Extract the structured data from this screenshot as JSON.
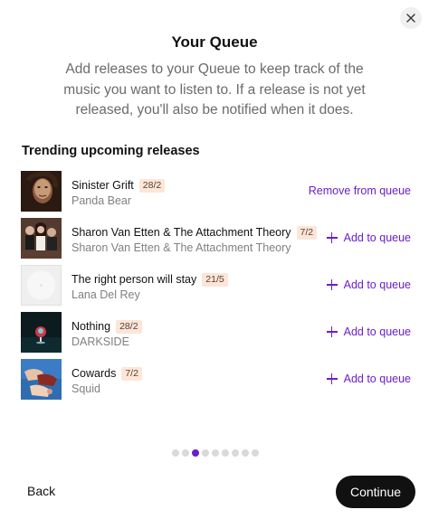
{
  "modal": {
    "title": "Your Queue",
    "description": "Add releases to your Queue to keep track of the music you want to listen to. If a release is not yet released, you'll also be notified when it does.",
    "section_title": "Trending upcoming releases"
  },
  "releases": [
    {
      "title": "Sinister Grift",
      "date": "28/2",
      "artist": "Panda Bear",
      "action": "Remove from queue",
      "in_queue": true,
      "cover": "portrait-painting"
    },
    {
      "title": "Sharon Van Etten & The Attachment Theory",
      "date": "7/2",
      "artist": "Sharon Van Etten & The Attachment Theory",
      "action": "Add to queue",
      "in_queue": false,
      "cover": "band-photo"
    },
    {
      "title": "The right person will stay",
      "date": "21/5",
      "artist": "Lana Del Rey",
      "action": "Add to queue",
      "in_queue": false,
      "cover": "blank-disc"
    },
    {
      "title": "Nothing",
      "date": "28/2",
      "artist": "DARKSIDE",
      "action": "Add to queue",
      "in_queue": false,
      "cover": "dark-orb"
    },
    {
      "title": "Cowards",
      "date": "7/2",
      "artist": "Squid",
      "action": "Add to queue",
      "in_queue": false,
      "cover": "hands-blue"
    }
  ],
  "pagination": {
    "total": 9,
    "current": 3
  },
  "footer": {
    "back_label": "Back",
    "continue_label": "Continue"
  },
  "colors": {
    "accent": "#6a1fc8",
    "badge_bg": "#fbe6d8",
    "primary_button": "#111111"
  }
}
